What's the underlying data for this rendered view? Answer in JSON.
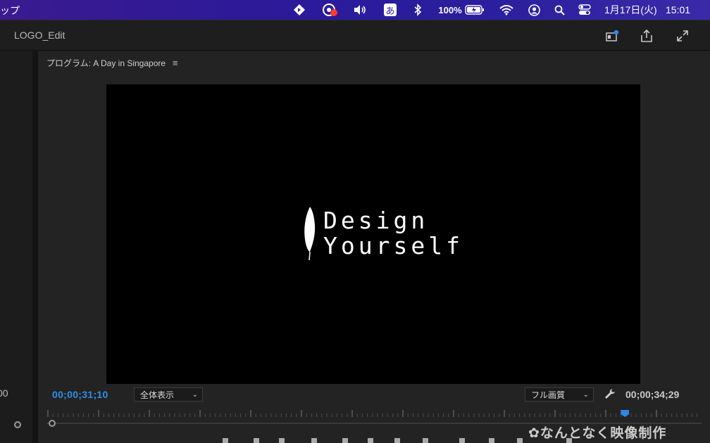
{
  "menubar": {
    "app_label": "ップ",
    "battery": "100%",
    "input_method": "あ",
    "date": "1月17日(火)",
    "time": "15:01",
    "icons": [
      "app-diamond-icon",
      "screen-record-icon",
      "volume-icon",
      "input-method-icon",
      "bluetooth-icon",
      "battery-icon",
      "wifi-icon",
      "user-icon",
      "search-icon",
      "control-center-icon"
    ]
  },
  "header": {
    "title": "LOGO_Edit",
    "icons": [
      "quick-export-icon",
      "share-icon",
      "fullscreen-icon"
    ]
  },
  "left_panel": {
    "timecode": "00"
  },
  "monitor": {
    "title": "プログラム: A Day in Singapore",
    "menu_glyph": "≡",
    "logo": {
      "line1": "Design",
      "line2": "Yourself"
    },
    "current_timecode": "00;00;31;10",
    "zoom_select": "全体表示",
    "quality_select": "フル画質",
    "duration_timecode": "00;00;34;29",
    "playhead_position": 0.883
  },
  "watermark": "なんとなく映像制作",
  "colors": {
    "accent": "#2f8fe8",
    "menubar_start": "#3a1a8f",
    "menubar_end": "#3a2aa8",
    "record_dot": "#ff3b30"
  }
}
